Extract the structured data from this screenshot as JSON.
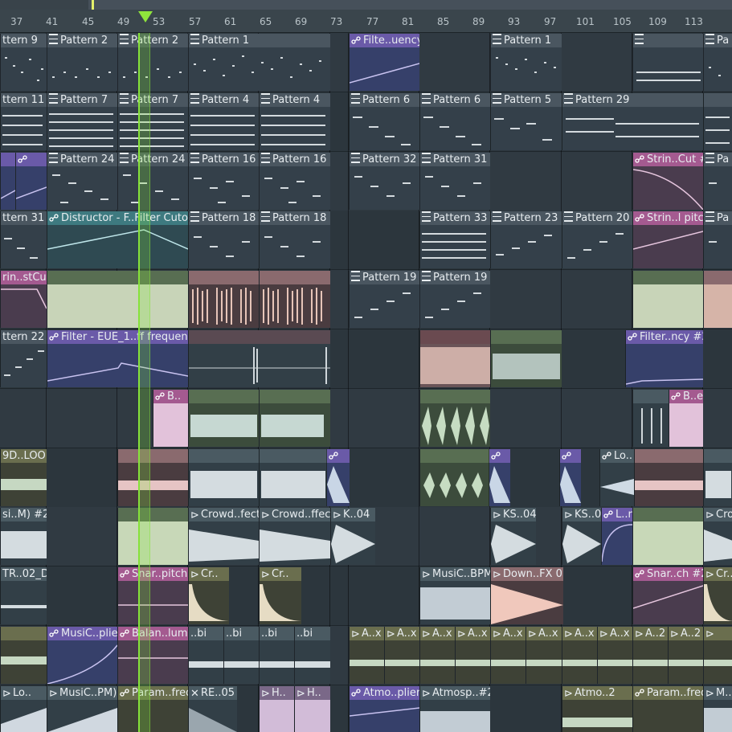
{
  "ruler": {
    "bars": [
      "37",
      "41",
      "45",
      "49",
      "53",
      "57",
      "61",
      "65",
      "69",
      "73",
      "77",
      "81",
      "85",
      "89",
      "93",
      "97",
      "101",
      "105",
      "109",
      "113"
    ]
  },
  "colors": {
    "playhead": "#86e23a",
    "pattern_header": "#4a5660",
    "automation_header": "#6a5aa8",
    "automation_pink_header": "#a45a90",
    "audio_green_header": "#586e52"
  },
  "clips": {
    "r0": [
      "ttern 9",
      "Pattern 2",
      "Pattern 2",
      "Pattern 1",
      "Filte..uency",
      "Pattern 1",
      "Pa"
    ],
    "r1": [
      "ttern 11",
      "Pattern 7",
      "Pattern 7",
      "Pattern 4",
      "Pattern 4",
      "Pattern 6",
      "Pattern 6",
      "Pattern 5",
      "Pattern 29"
    ],
    "r2": [
      "Pattern 24",
      "Pattern 24",
      "Pattern 16",
      "Pattern 16",
      "Pattern 32",
      "Pattern 31",
      "Strin..Cut #2",
      "Pa"
    ],
    "r3": [
      "ttern 31",
      "Distructor - F..Filter Cutoff",
      "Pattern 18",
      "Pattern 18",
      "Pattern 33",
      "Pattern 23",
      "Pattern 20",
      "Strin..l pitch",
      "Pa"
    ],
    "r4": [
      "rin..stCut",
      "Pattern 19",
      "Pattern 19"
    ],
    "r5": [
      "ttern 22",
      "Filter - EUE_1..ff frequency",
      "Filter..ncy #2"
    ],
    "r6": [
      "B..",
      "B..e"
    ],
    "r7": [
      "9D..LOOP",
      "Lo.."
    ],
    "r8": [
      "si..M) #2",
      "Crowd..fect",
      "Crowd..ffect",
      "K..04",
      "KS..04",
      "KS..0",
      "L..r",
      "Cro"
    ],
    "r9": [
      "TR..02_D",
      "Snar..pitch",
      "Cr..",
      "Cr..",
      "MusiC..BPM)",
      "Down..FX 01",
      "Snar..ch #2",
      "Cr.."
    ],
    "r10": [
      "MusiC..plier",
      "Balan..lume",
      "..bi",
      "..bi",
      "..bi",
      "..bi",
      "A..x",
      "A..x",
      "A..x",
      "A..x",
      "A..x",
      "A..x",
      "A..x",
      "A..x",
      "A..x",
      "A..2",
      "A..2"
    ],
    "r11": [
      "Lo..",
      "MusiC..PM)",
      "Param..freq",
      "RE..05",
      "H..",
      "H..",
      "Atmo..plier",
      "Atmosp..#2",
      "Atmo..2",
      "Param..freq",
      "M.."
    ]
  }
}
